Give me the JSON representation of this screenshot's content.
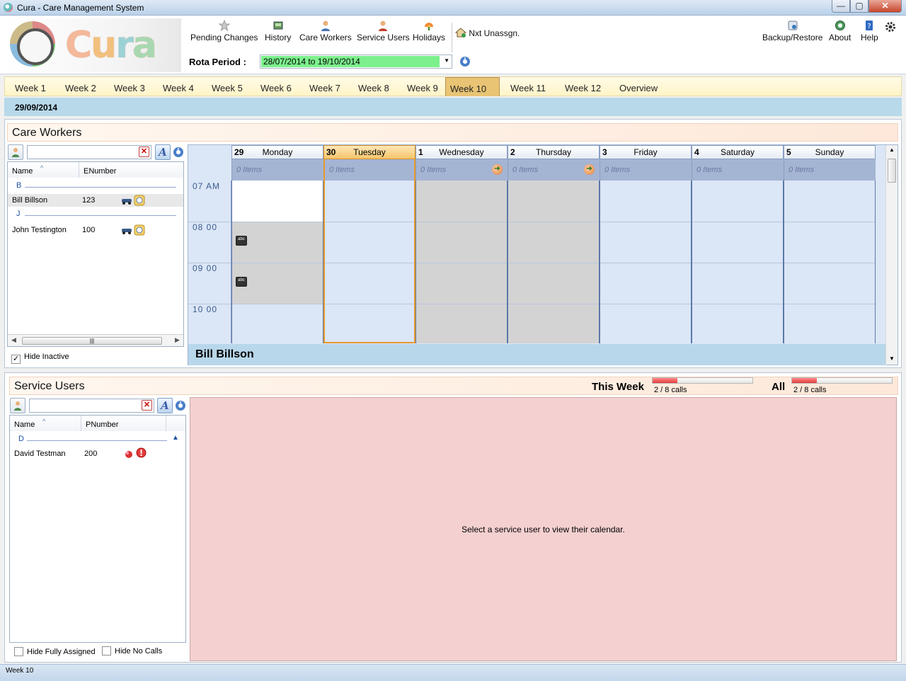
{
  "window": {
    "title": "Cura  -  Care Management System",
    "min": "—",
    "max": "▢",
    "close": "✕"
  },
  "brand": {
    "logo_text": [
      "C",
      "u",
      "r",
      "a"
    ]
  },
  "toolbar": {
    "pending_changes": "Pending Changes",
    "history": "History",
    "care_workers": "Care Workers",
    "service_users": "Service Users",
    "holidays": "Holidays",
    "nxt_unassigned": "Nxt Unassgn.",
    "backup_restore": "Backup/Restore",
    "about": "About",
    "help": "Help"
  },
  "rota": {
    "label": "Rota Period :",
    "value": "28/07/2014   to   19/10/2014"
  },
  "weeks": [
    "Week 1",
    "Week 2",
    "Week 3",
    "Week 4",
    "Week 5",
    "Week 6",
    "Week 7",
    "Week 8",
    "Week 9",
    "Week 10",
    "Week 11",
    "Week 12",
    "Overview"
  ],
  "active_week": "Week 10",
  "current_date": "29/09/2014",
  "care_workers": {
    "title": "Care Workers",
    "columns": [
      "Name",
      "ENumber"
    ],
    "groups": [
      {
        "letter": "B",
        "rows": [
          {
            "name": "Bill Billson",
            "number": "123"
          }
        ]
      },
      {
        "letter": "J",
        "rows": [
          {
            "name": "John Testington",
            "number": "100"
          }
        ]
      }
    ],
    "hide_inactive": "Hide Inactive",
    "hide_inactive_checked": true,
    "selected_worker": "Bill Billson"
  },
  "calendar": {
    "days": [
      {
        "num": "29",
        "name": "Monday",
        "items": "0 Items"
      },
      {
        "num": "30",
        "name": "Tuesday",
        "items": "0 Items"
      },
      {
        "num": "1",
        "name": "Wednesday",
        "items": "0 Items"
      },
      {
        "num": "2",
        "name": "Thursday",
        "items": "0 Items"
      },
      {
        "num": "3",
        "name": "Friday",
        "items": "0 Items"
      },
      {
        "num": "4",
        "name": "Saturday",
        "items": "0 Items"
      },
      {
        "num": "5",
        "name": "Sunday",
        "items": "0 Items"
      }
    ],
    "today_index": 1,
    "times": [
      "07  AM",
      "08  00",
      "09  00",
      "10  00"
    ],
    "bus_icon_text": "abc"
  },
  "service_users": {
    "title": "Service Users",
    "this_week_label": "This Week",
    "this_week_calls": "2 / 8 calls",
    "this_week_fraction": 0.25,
    "all_label": "All",
    "all_calls": "2 / 8 calls",
    "all_fraction": 0.25,
    "columns": [
      "Name",
      "PNumber"
    ],
    "groups": [
      {
        "letter": "D",
        "rows": [
          {
            "name": "David Testman",
            "number": "200"
          }
        ]
      }
    ],
    "hide_fully_assigned": "Hide Fully Assigned",
    "hide_no_calls": "Hide No Calls",
    "empty_message": "Select a service user to view their calendar."
  },
  "status": {
    "text": "Week 10"
  },
  "colors": {
    "accent": "#e8c474",
    "rota_highlight": "#7cf08c",
    "today": "#f5c56a"
  }
}
